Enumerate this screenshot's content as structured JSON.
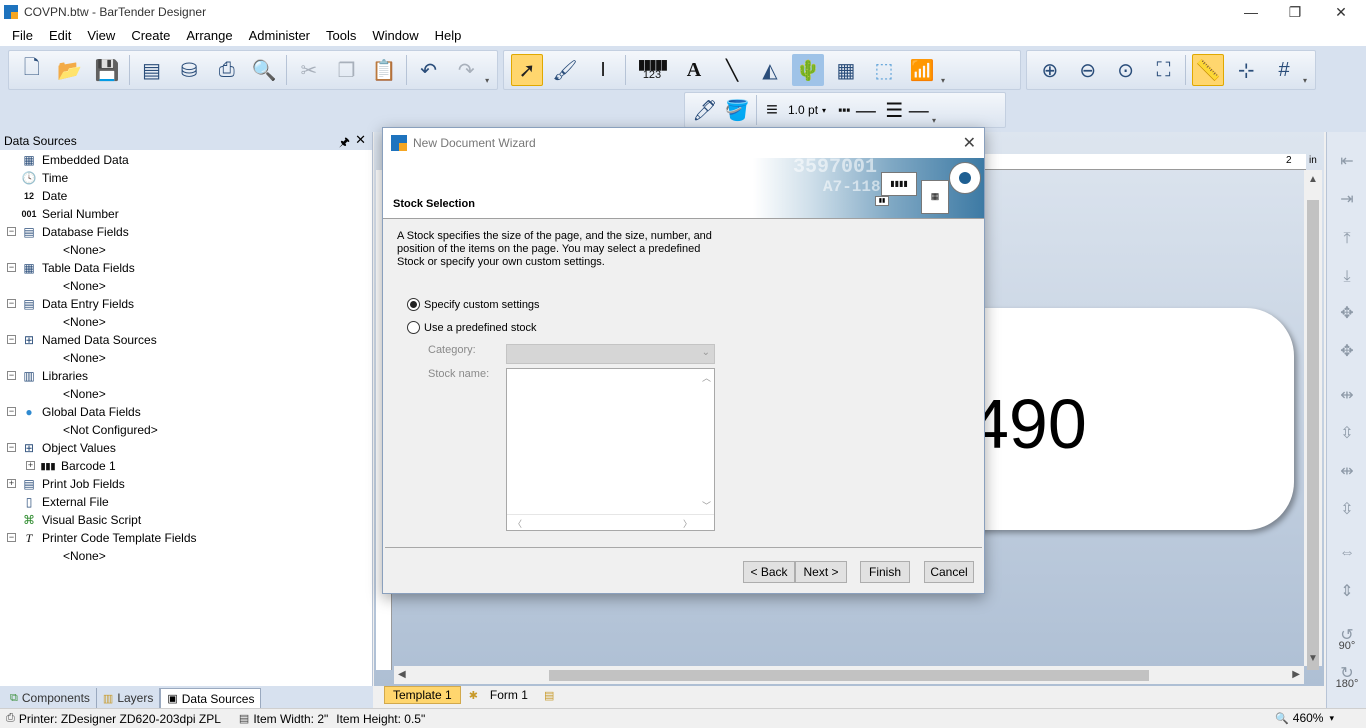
{
  "window": {
    "title": "COVPN.btw - BarTender Designer",
    "minimize": "—",
    "restore": "❐",
    "close": "✕"
  },
  "menu": [
    "File",
    "Edit",
    "View",
    "Create",
    "Arrange",
    "Administer",
    "Tools",
    "Window",
    "Help"
  ],
  "toolbar": {
    "line_width": "1.0 pt",
    "barcode_caption": "123"
  },
  "data_sources_panel": {
    "title": "Data Sources",
    "pin": "🖈",
    "close": "✕",
    "tree": [
      {
        "label": "Embedded Data",
        "icon": "embedded-data-icon",
        "glyph": "▦"
      },
      {
        "label": "Time",
        "icon": "clock-icon",
        "glyph": "🕓"
      },
      {
        "label": "Date",
        "icon": "calendar-icon",
        "glyph": "12"
      },
      {
        "label": "Serial Number",
        "icon": "serial-number-icon",
        "glyph": "001"
      },
      {
        "label": "Database Fields",
        "icon": "database-icon",
        "glyph": "▤"
      },
      {
        "label": "<None>",
        "icon": "",
        "glyph": ""
      },
      {
        "label": "Table Data Fields",
        "icon": "table-icon",
        "glyph": "▦"
      },
      {
        "label": "<None>",
        "icon": "",
        "glyph": ""
      },
      {
        "label": "Data Entry Fields",
        "icon": "form-icon",
        "glyph": "▤"
      },
      {
        "label": "<None>",
        "icon": "",
        "glyph": ""
      },
      {
        "label": "Named Data Sources",
        "icon": "named-source-icon",
        "glyph": "⊞"
      },
      {
        "label": "<None>",
        "icon": "",
        "glyph": ""
      },
      {
        "label": "Libraries",
        "icon": "library-icon",
        "glyph": "▥"
      },
      {
        "label": "<None>",
        "icon": "",
        "glyph": ""
      },
      {
        "label": "Global Data Fields",
        "icon": "globe-icon",
        "glyph": "●"
      },
      {
        "label": "<Not Configured>",
        "icon": "",
        "glyph": ""
      },
      {
        "label": "Object Values",
        "icon": "object-values-icon",
        "glyph": "⊞"
      },
      {
        "label": "Barcode 1",
        "icon": "barcode-icon",
        "glyph": "▮▮▮"
      },
      {
        "label": "Print Job Fields",
        "icon": "print-job-icon",
        "glyph": "▤"
      },
      {
        "label": "External File",
        "icon": "file-icon",
        "glyph": "▯"
      },
      {
        "label": "Visual Basic Script",
        "icon": "script-icon",
        "glyph": "⌘"
      },
      {
        "label": "Printer Code Template Fields",
        "icon": "template-field-icon",
        "glyph": "T"
      },
      {
        "label": "<None>",
        "icon": "",
        "glyph": ""
      }
    ],
    "tabs": [
      "Components",
      "Layers",
      "Data Sources"
    ]
  },
  "canvas": {
    "ruler_number": "2",
    "ruler_unit": "in",
    "label_text": "490",
    "template_tabs": [
      "Template 1",
      "Form 1"
    ]
  },
  "align_bar": {
    "rotate_90": "90°",
    "rotate_180": "180°"
  },
  "status": {
    "printer": "Printer: ZDesigner ZD620-203dpi ZPL",
    "item_width": "Item Width: 2\"",
    "item_height": "Item Height: 0.5\"",
    "zoom": "460%",
    "zoom_chevron": "▾"
  },
  "dialog": {
    "title": "New Document Wizard",
    "close": "✕",
    "heading": "Stock Selection",
    "banner_code_1": "3597001",
    "banner_code_2": "A7-118",
    "description": "A Stock specifies the size of the page, and the size, number, and position of the items on the page. You may select a predefined Stock or specify your own custom settings.",
    "option_custom": "Specify custom settings",
    "option_predefined": "Use a predefined stock",
    "selected_option": "custom",
    "category_label": "Category:",
    "category_value": "",
    "stock_name_label": "Stock name:",
    "buttons": {
      "back": "< Back",
      "next": "Next >",
      "finish": "Finish",
      "cancel": "Cancel"
    }
  }
}
